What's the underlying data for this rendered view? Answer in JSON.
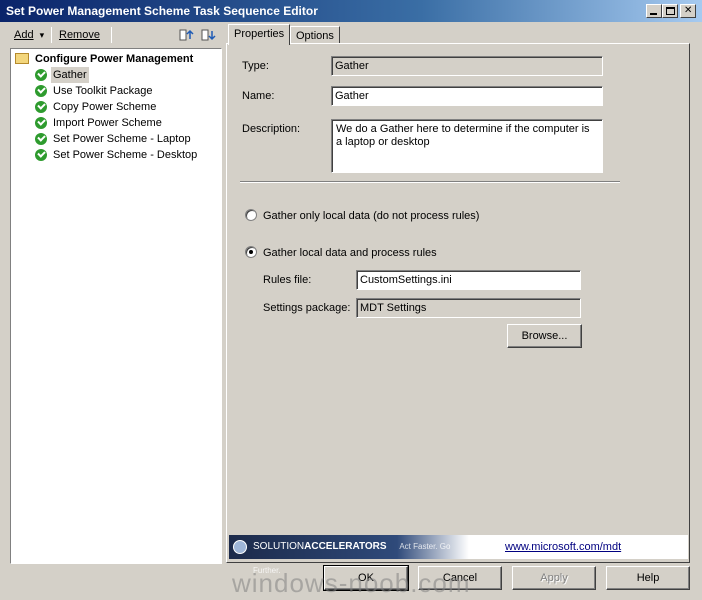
{
  "window": {
    "title": "Set Power Management Scheme Task Sequence Editor",
    "controls": {
      "minimize": "_",
      "maximize": "□",
      "close": "✕"
    }
  },
  "toolbar": {
    "add_label": "Add",
    "remove_label": "Remove",
    "dropdown_glyph": "▾"
  },
  "tree": {
    "root_label": "Configure Power Management",
    "items": [
      {
        "label": "Gather",
        "selected": true
      },
      {
        "label": "Use Toolkit Package"
      },
      {
        "label": "Copy Power Scheme"
      },
      {
        "label": "Import Power Scheme"
      },
      {
        "label": "Set Power Scheme - Laptop"
      },
      {
        "label": "Set Power Scheme - Desktop"
      }
    ]
  },
  "tabs": [
    {
      "label": "Properties",
      "active": true
    },
    {
      "label": "Options"
    }
  ],
  "properties": {
    "type_label": "Type:",
    "type_value": "Gather",
    "name_label": "Name:",
    "name_value": "Gather",
    "description_label": "Description:",
    "description_value": "We do a Gather here to determine if the computer is a laptop or desktop",
    "radio_local_only": "Gather only local data (do not process rules)",
    "radio_process_rules": "Gather local data and process rules",
    "rules_file_label": "Rules file:",
    "rules_file_value": "CustomSettings.ini",
    "settings_package_label": "Settings package:",
    "settings_package_value": "MDT Settings",
    "browse_label": "Browse..."
  },
  "banner": {
    "brand_prefix": "SOLUTION",
    "brand_strong": "ACCELERATORS",
    "tagline": "Act Faster. Go Further.",
    "link": "www.microsoft.com/mdt"
  },
  "buttons": {
    "ok": "OK",
    "cancel": "Cancel",
    "apply": "Apply",
    "help": "Help"
  },
  "watermark": "windows-noob.com",
  "colors": {
    "titlebar_start": "#0a246a",
    "titlebar_end": "#a6caf0",
    "check_green": "#2e9b2e",
    "link": "#000080"
  }
}
